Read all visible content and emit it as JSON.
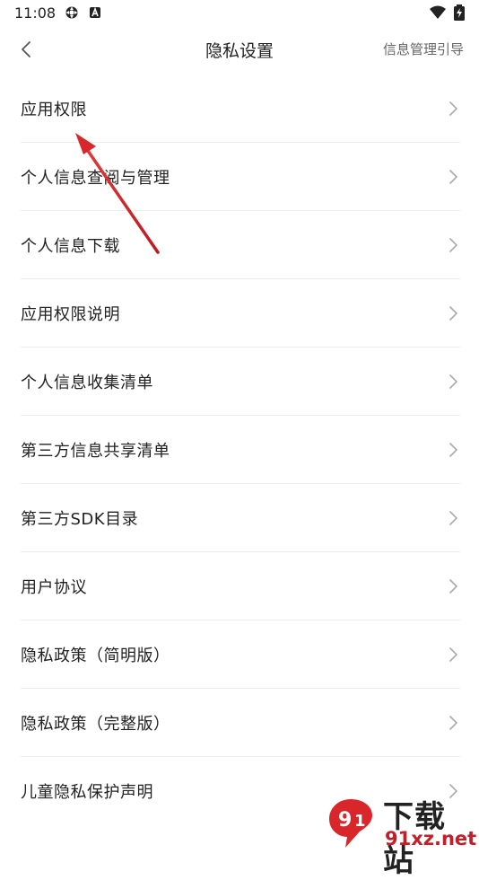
{
  "status": {
    "time": "11:08",
    "icons": [
      "sync-icon",
      "a-notification-icon",
      "wifi-icon",
      "battery-charging-icon"
    ]
  },
  "header": {
    "back_icon": "chevron-left-icon",
    "title": "隐私设置",
    "guide_link": "信息管理引导"
  },
  "list": {
    "items": [
      {
        "label": "应用权限"
      },
      {
        "label": "个人信息查阅与管理"
      },
      {
        "label": "个人信息下载"
      },
      {
        "label": "应用权限说明"
      },
      {
        "label": "个人信息收集清单"
      },
      {
        "label": "第三方信息共享清单"
      },
      {
        "label": "第三方SDK目录"
      },
      {
        "label": "用户协议"
      },
      {
        "label": "隐私政策（简明版）"
      },
      {
        "label": "隐私政策（完整版）"
      },
      {
        "label": "儿童隐私保护声明"
      }
    ],
    "chevron_icon": "chevron-right-icon"
  },
  "watermark": {
    "top_text": "下载站",
    "bottom_text": "91xz.net"
  },
  "colors": {
    "annotation_arrow": "#d8262b",
    "watermark_red": "#c0202a"
  }
}
